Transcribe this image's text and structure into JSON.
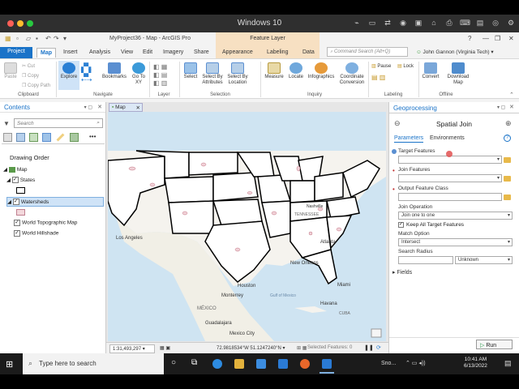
{
  "mac_window": {
    "title": "Windows 10"
  },
  "app": {
    "title": "MyProject36 - Map - ArcGIS Pro",
    "context_tab": "Feature Layer",
    "help": "?",
    "tabs": [
      "Project",
      "Map",
      "Insert",
      "Analysis",
      "View",
      "Edit",
      "Imagery",
      "Share",
      "Appearance",
      "Labeling",
      "Data"
    ],
    "command_search": {
      "placeholder": "Command Search (Alt+Q)"
    },
    "user": "John Gannon (Virginia Tech)"
  },
  "ribbon": {
    "clipboard": {
      "paste": "Paste",
      "cut": "Cut",
      "copy": "Copy",
      "copy_path": "Copy Path",
      "label": "Clipboard"
    },
    "navigate": {
      "explore": "Explore",
      "bookmarks": "Bookmarks",
      "goto": "Go To XY",
      "label": "Navigate"
    },
    "layer": {
      "label": "Layer"
    },
    "selection": {
      "select": "Select",
      "by_attributes": "Select By Attributes",
      "by_location": "Select By Location",
      "label": "Selection"
    },
    "inquiry": {
      "measure": "Measure",
      "locate": "Locate",
      "infographics": "Infographics",
      "coordinate": "Coordinate Conversion",
      "label": "Inquiry"
    },
    "labeling": {
      "pause": "Pause",
      "lock": "Lock",
      "label": "Labeling"
    },
    "offline": {
      "convert": "Convert",
      "download": "Download Map",
      "label": "Offline"
    }
  },
  "contents": {
    "title": "Contents",
    "search_placeholder": "Search",
    "drawing_order": "Drawing Order",
    "map": "Map",
    "layers": [
      "States",
      "Watersheds",
      "World Topographic Map",
      "World Hillshade"
    ]
  },
  "map_view": {
    "tab": "Map",
    "scale": "1:31,493,297",
    "coords": "72.9818534°W 51.1247240°N",
    "selected": "Selected Features: 0",
    "labels": {
      "los_angeles": "Los Angeles",
      "houston": "Houston",
      "monterrey": "Monterrey",
      "mexico": "MÉXICO",
      "guadalajara": "Guadalajara",
      "mexico_city": "Mexico City",
      "gulf": "Gulf of Mexico",
      "miami": "Miami",
      "havana": "Havana",
      "cuba": "CUBA",
      "atlanta": "Atlanta",
      "new_orleans": "New Orleans",
      "nashville": "Nashville",
      "tennessee": "TENNESSEE"
    }
  },
  "geoprocessing": {
    "header": "Geoprocessing",
    "tool": "Spatial Join",
    "tab_parameters": "Parameters",
    "tab_environments": "Environments",
    "target_features": "Target Features",
    "join_features": "Join Features",
    "output_feature_class": "Output Feature Class",
    "join_operation": "Join Operation",
    "join_operation_value": "Join one to one",
    "keep_all": "Keep All Target Features",
    "match_option": "Match Option",
    "match_option_value": "Intersect",
    "search_radius": "Search Radius",
    "search_radius_unit": "Unknown",
    "fields": "Fields",
    "run": "Run"
  },
  "taskbar": {
    "search": "Type here to search",
    "snow": "Sno...",
    "time": "10:41 AM",
    "date": "6/13/2022"
  }
}
